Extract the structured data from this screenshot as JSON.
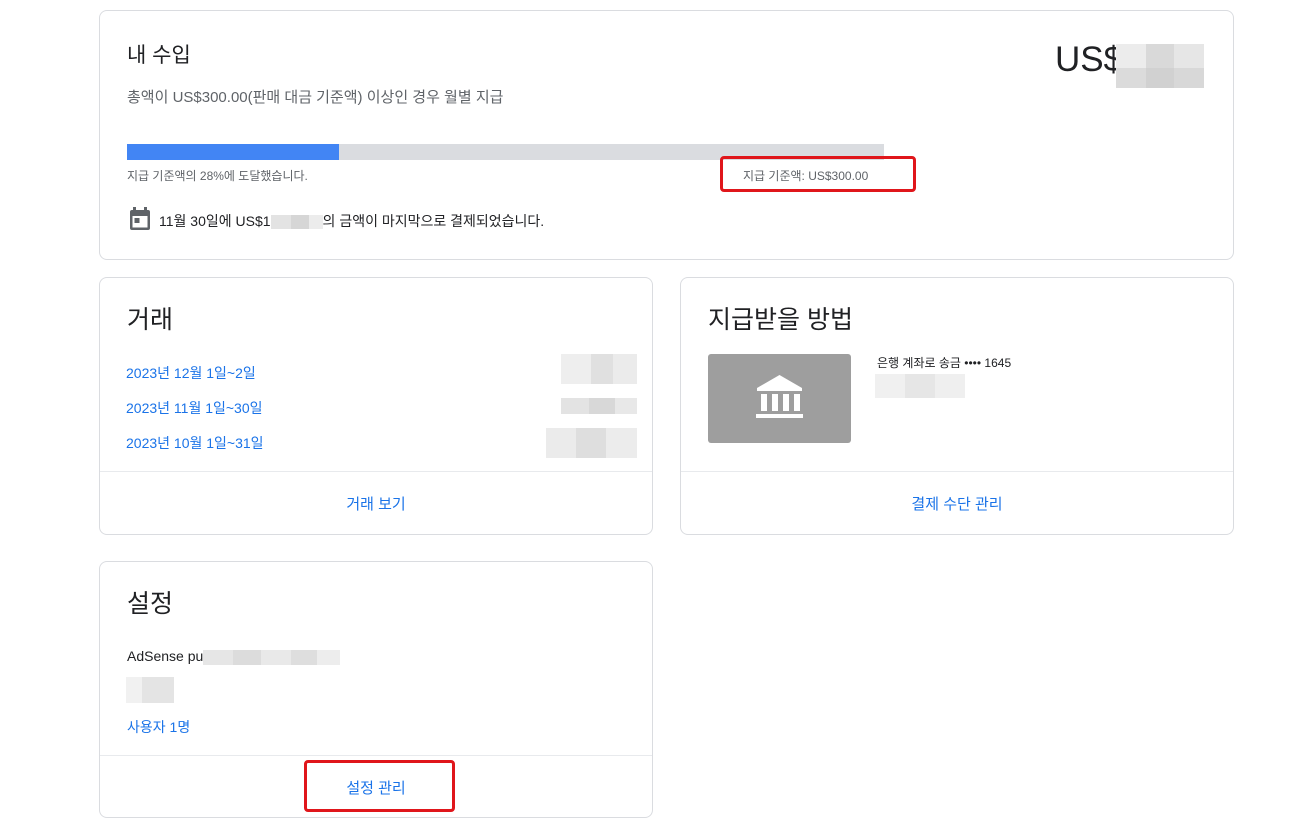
{
  "earnings": {
    "title": "내 수입",
    "amount_prefix": "US$",
    "threshold_note": "총액이 US$300.00(판매 대금 기준액) 이상인 경우 월별 지급",
    "progress_fraction": 0.28,
    "progress_text": "지급 기준액의 28%에 도달했습니다.",
    "threshold_label": "지급 기준액: US$300.00",
    "last_payment_prefix": "11월 30일에 US$1",
    "last_payment_suffix": "의 금액이 마지막으로 결제되었습니다.",
    "calendar_icon": "calendar-icon"
  },
  "transactions": {
    "title": "거래",
    "items": [
      {
        "period": "2023년 12월 1일~2일"
      },
      {
        "period": "2023년 11월 1일~30일"
      },
      {
        "period": "2023년 10월 1일~31일"
      }
    ],
    "view_link": "거래 보기"
  },
  "payment_method": {
    "title": "지급받을 방법",
    "bank_label": "은행 계좌로 송금 •••• 1645",
    "bank_icon": "bank-icon",
    "manage_link": "결제 수단 관리"
  },
  "settings": {
    "title": "설정",
    "adsense_prefix": "AdSense pu",
    "users_link": "사용자 1명",
    "manage_link": "설정 관리"
  },
  "colors": {
    "progress_fill": "#4285f4",
    "progress_track": "#dadce0",
    "link": "#1a73e8",
    "highlight": "#e0161b",
    "bank_tile": "#9e9e9e"
  }
}
